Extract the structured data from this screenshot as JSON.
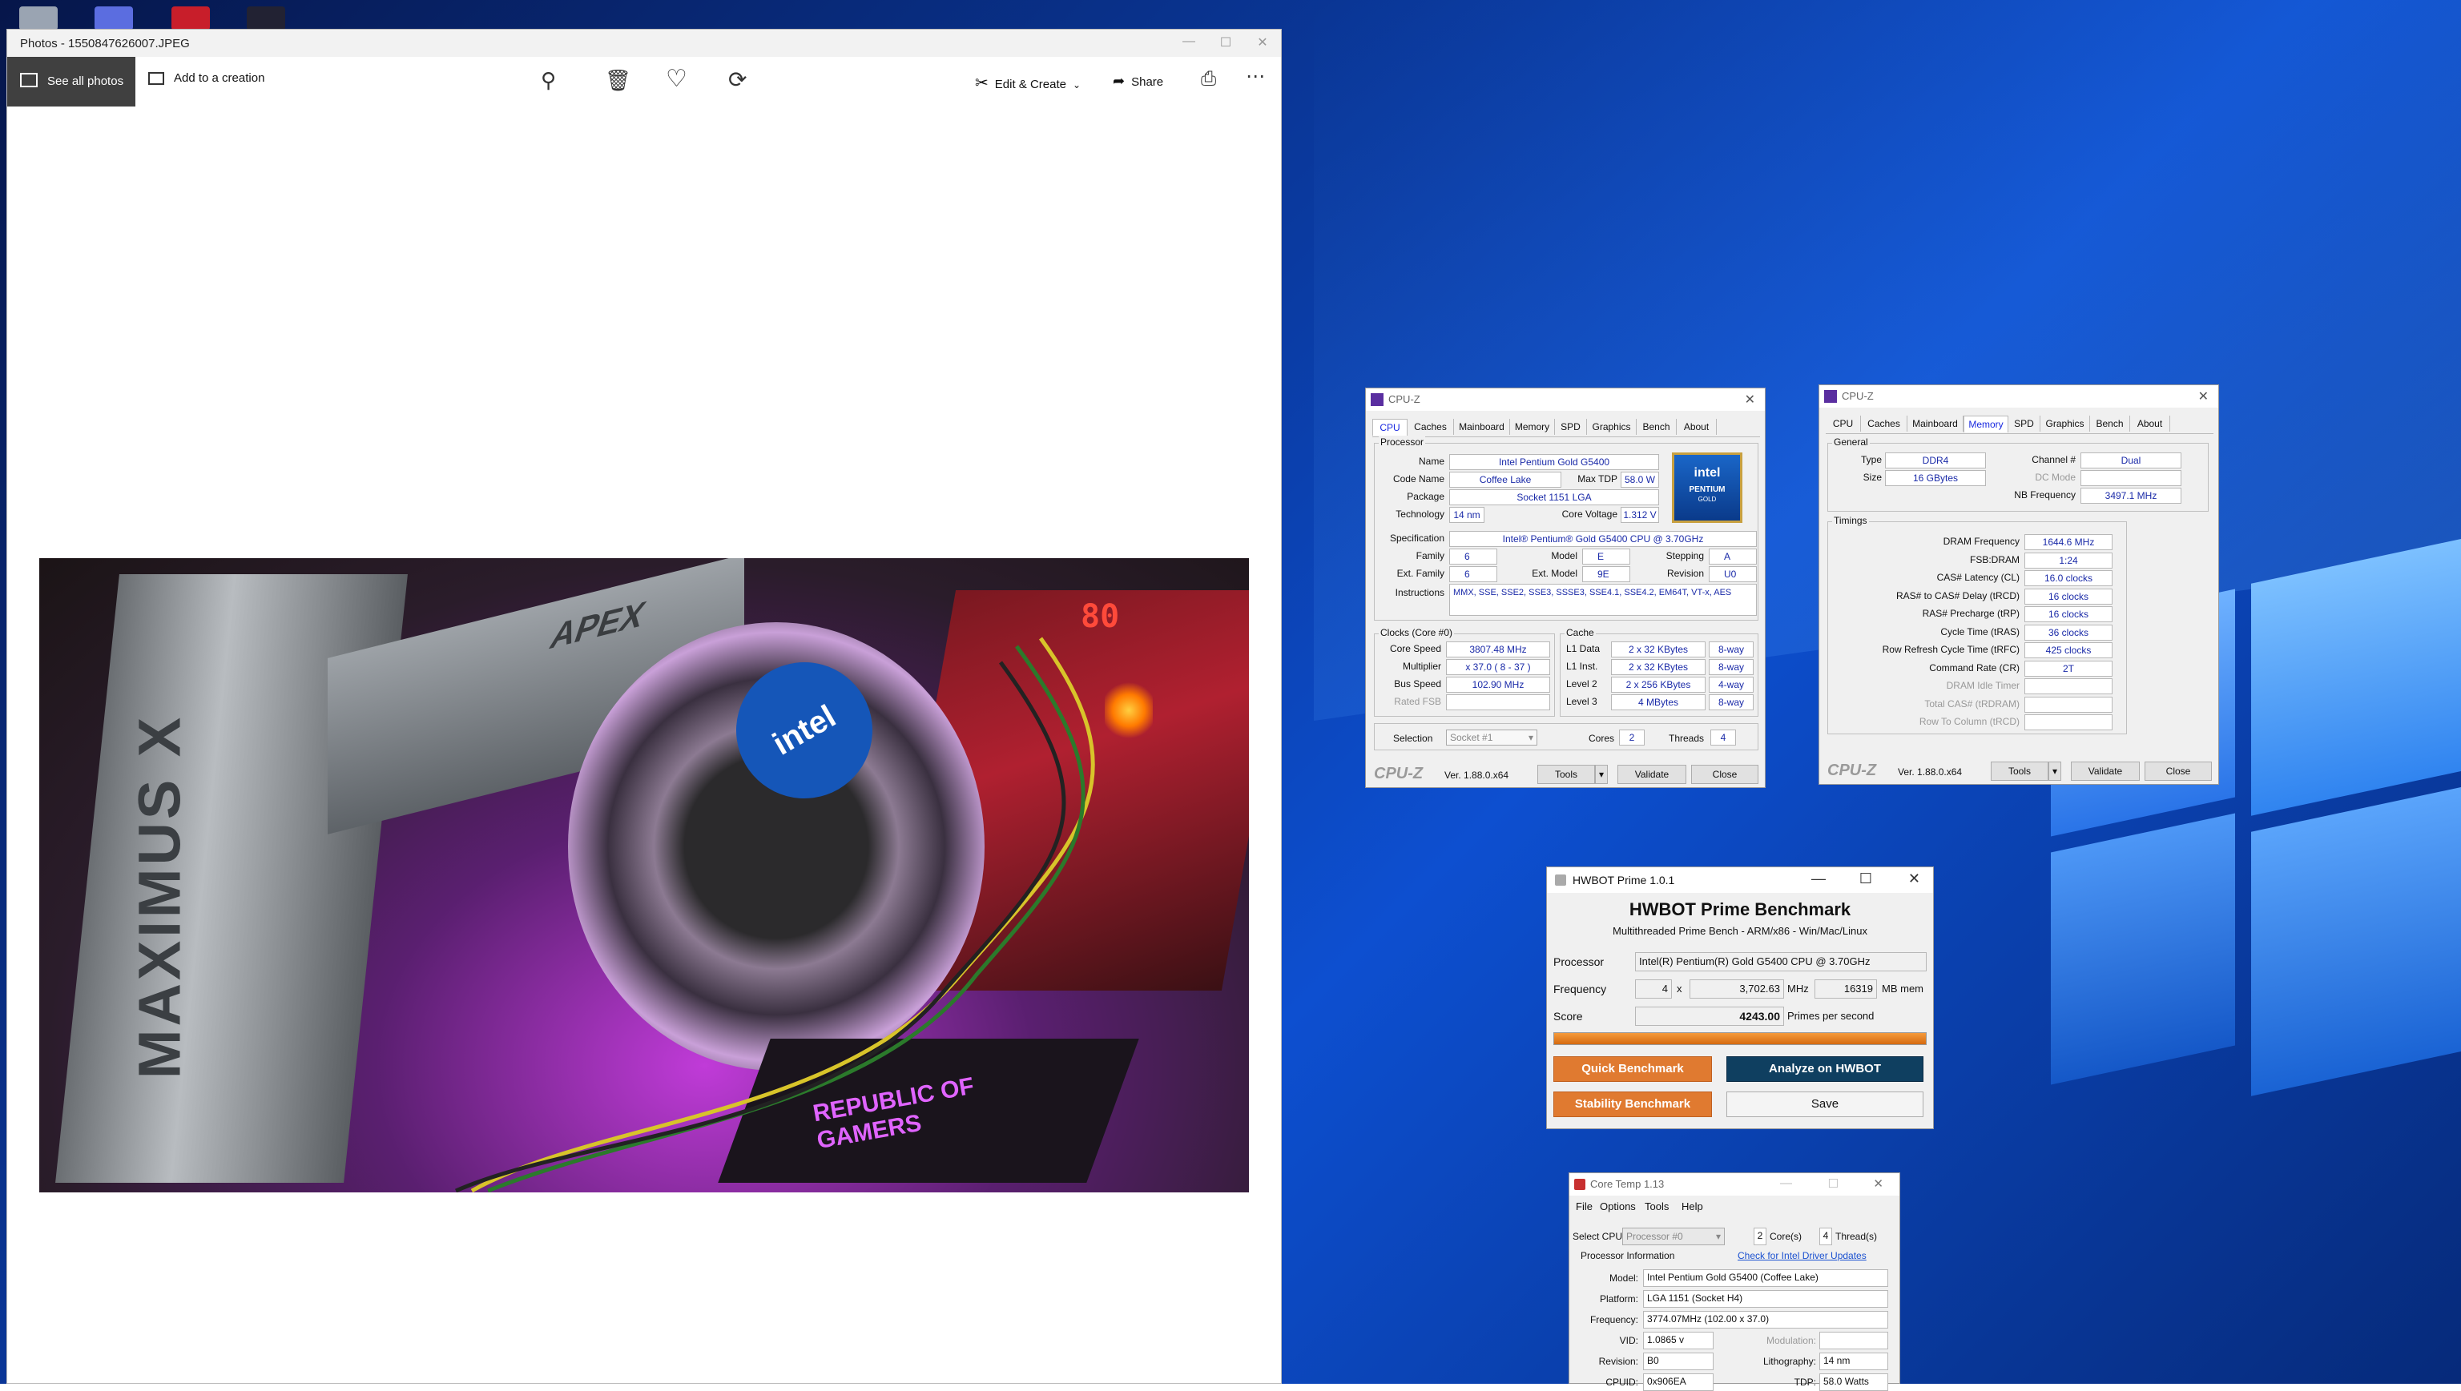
{
  "photos": {
    "title": "Photos - 1550847626007.JPEG",
    "see_all": "See all photos",
    "add_creation": "Add to a creation",
    "edit_create": "Edit & Create",
    "share": "Share"
  },
  "cpuz1": {
    "title": "CPU-Z",
    "tabs": [
      "CPU",
      "Caches",
      "Mainboard",
      "Memory",
      "SPD",
      "Graphics",
      "Bench",
      "About"
    ],
    "processor_group": "Processor",
    "name_label": "Name",
    "name": "Intel Pentium Gold G5400",
    "codename_label": "Code Name",
    "codename": "Coffee Lake",
    "maxtdp_label": "Max TDP",
    "maxtdp": "58.0 W",
    "package_label": "Package",
    "package": "Socket 1151 LGA",
    "technology_label": "Technology",
    "technology": "14 nm",
    "corevoltage_label": "Core Voltage",
    "corevoltage": "1.312 V",
    "spec_label": "Specification",
    "spec": "Intel® Pentium® Gold G5400 CPU @ 3.70GHz",
    "family_label": "Family",
    "family": "6",
    "model_label": "Model",
    "model": "E",
    "stepping_label": "Stepping",
    "stepping": "A",
    "extfamily_label": "Ext. Family",
    "extfamily": "6",
    "extmodel_label": "Ext. Model",
    "extmodel": "9E",
    "revision_label": "Revision",
    "revision": "U0",
    "instructions_label": "Instructions",
    "instructions": "MMX, SSE, SSE2, SSE3, SSSE3, SSE4.1, SSE4.2, EM64T, VT-x, AES",
    "clocks_group": "Clocks (Core #0)",
    "corespeed_label": "Core Speed",
    "corespeed": "3807.48 MHz",
    "multiplier_label": "Multiplier",
    "multiplier": "x 37.0 ( 8 - 37 )",
    "busspeed_label": "Bus Speed",
    "busspeed": "102.90 MHz",
    "ratedfsb_label": "Rated FSB",
    "cache_group": "Cache",
    "l1d_label": "L1 Data",
    "l1d": "2 x 32 KBytes",
    "l1d_way": "8-way",
    "l1i_label": "L1 Inst.",
    "l1i": "2 x 32 KBytes",
    "l1i_way": "8-way",
    "l2_label": "Level 2",
    "l2": "2 x 256 KBytes",
    "l2_way": "4-way",
    "l3_label": "Level 3",
    "l3": "4 MBytes",
    "l3_way": "8-way",
    "selection_label": "Selection",
    "selection": "Socket #1",
    "cores_label": "Cores",
    "cores": "2",
    "threads_label": "Threads",
    "threads": "4",
    "brand": "CPU-Z",
    "version": "Ver. 1.88.0.x64",
    "tools": "Tools",
    "validate": "Validate",
    "close": "Close",
    "logo_intel": "intel",
    "logo_pentium": "PENTIUM",
    "logo_gold": "GOLD"
  },
  "cpuz2": {
    "title": "CPU-Z",
    "tabs": [
      "CPU",
      "Caches",
      "Mainboard",
      "Memory",
      "SPD",
      "Graphics",
      "Bench",
      "About"
    ],
    "general_group": "General",
    "type_label": "Type",
    "type": "DDR4",
    "channel_label": "Channel #",
    "channel": "Dual",
    "size_label": "Size",
    "size": "16 GBytes",
    "dcmode_label": "DC Mode",
    "nbfreq_label": "NB Frequency",
    "nbfreq": "3497.1 MHz",
    "timings_group": "Timings",
    "timings": [
      {
        "label": "DRAM Frequency",
        "value": "1644.6 MHz"
      },
      {
        "label": "FSB:DRAM",
        "value": "1:24"
      },
      {
        "label": "CAS# Latency (CL)",
        "value": "16.0 clocks"
      },
      {
        "label": "RAS# to CAS# Delay (tRCD)",
        "value": "16 clocks"
      },
      {
        "label": "RAS# Precharge (tRP)",
        "value": "16 clocks"
      },
      {
        "label": "Cycle Time (tRAS)",
        "value": "36 clocks"
      },
      {
        "label": "Row Refresh Cycle Time (tRFC)",
        "value": "425 clocks"
      },
      {
        "label": "Command Rate (CR)",
        "value": "2T"
      },
      {
        "label": "DRAM Idle Timer",
        "value": ""
      },
      {
        "label": "Total CAS# (tRDRAM)",
        "value": ""
      },
      {
        "label": "Row To Column (tRCD)",
        "value": ""
      }
    ],
    "brand": "CPU-Z",
    "version": "Ver. 1.88.0.x64",
    "tools": "Tools",
    "validate": "Validate",
    "close": "Close"
  },
  "hwbot": {
    "title": "HWBOT Prime 1.0.1",
    "heading": "HWBOT Prime Benchmark",
    "subheading": "Multithreaded Prime Bench - ARM/x86 - Win/Mac/Linux",
    "processor_label": "Processor",
    "processor": "Intel(R) Pentium(R) Gold G5400 CPU @ 3.70GHz",
    "frequency_label": "Frequency",
    "threads": "4",
    "x": "x",
    "freq": "3,702.63",
    "mhz": "MHz",
    "mem": "16319",
    "mbmem": "MB mem",
    "score_label": "Score",
    "score": "4243.00",
    "pps": "Primes per second",
    "quick": "Quick Benchmark",
    "analyze": "Analyze on HWBOT",
    "stability": "Stability Benchmark",
    "save": "Save"
  },
  "coretemp": {
    "title": "Core Temp 1.13",
    "menu": [
      "File",
      "Options",
      "Tools",
      "Help"
    ],
    "selectcpu_label": "Select CPU:",
    "selectcpu": "Processor #0",
    "cores": "2",
    "cores_label": "Core(s)",
    "threads": "4",
    "threads_label": "Thread(s)",
    "procinfo": "Processor Information",
    "driverlink": "Check for Intel Driver Updates",
    "model_label": "Model:",
    "model": "Intel Pentium Gold G5400 (Coffee Lake)",
    "platform_label": "Platform:",
    "platform": "LGA 1151 (Socket H4)",
    "frequency_label": "Frequency:",
    "frequency": "3774.07MHz (102.00 x 37.0)",
    "vid_label": "VID:",
    "vid": "1.0865 v",
    "modulation_label": "Modulation:",
    "revision_label": "Revision:",
    "revision": "B0",
    "litho_label": "Lithography:",
    "litho": "14 nm",
    "cpuid_label": "CPUID:",
    "cpuid": "0x906EA",
    "tdp_label": "TDP:",
    "tdp": "58.0 Watts"
  },
  "photo": {
    "board_text": "MAXIMUS X",
    "apex": "APEX",
    "rog1": "REPUBLIC OF",
    "rog2": "GAMERS",
    "code": "80",
    "fan_brand": "intel"
  }
}
